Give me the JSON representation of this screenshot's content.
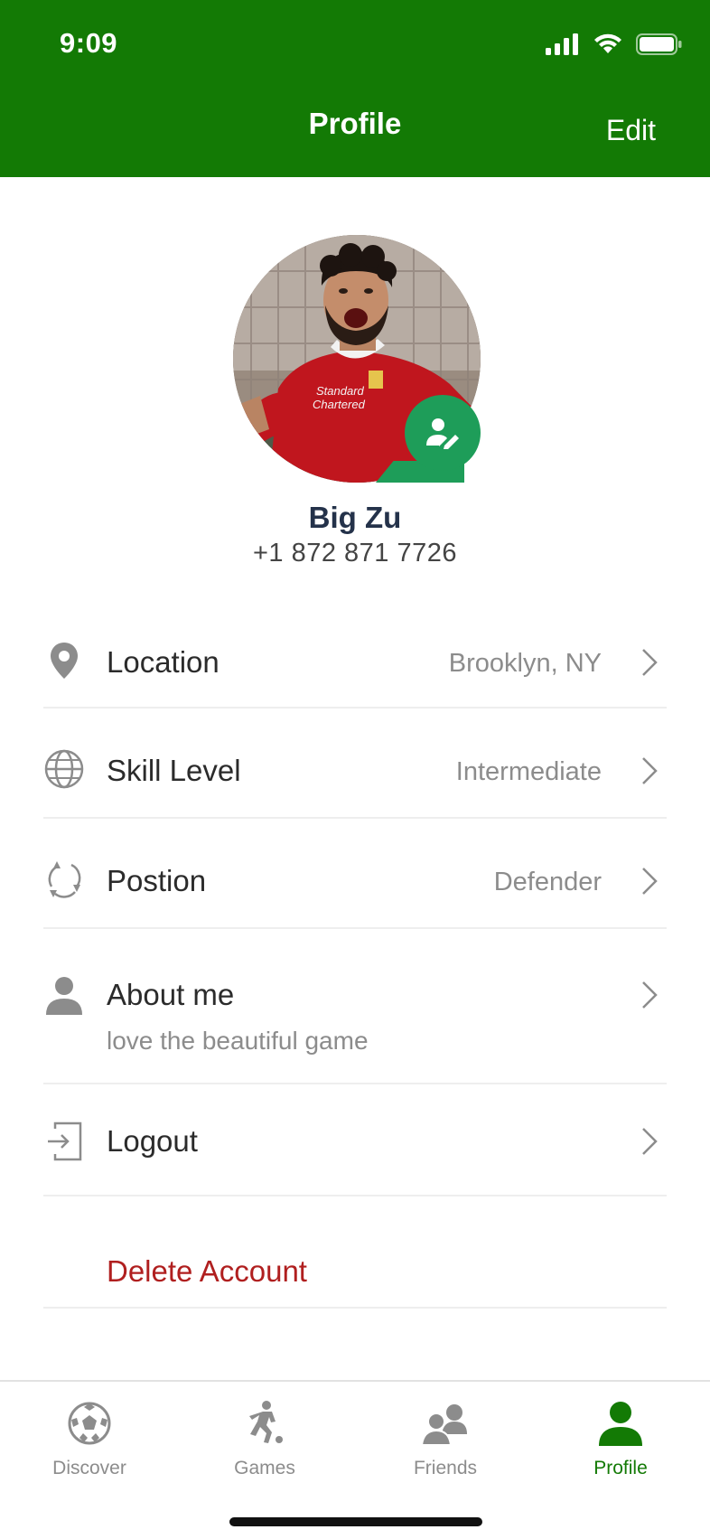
{
  "status_bar": {
    "time": "9:09"
  },
  "header": {
    "title": "Profile",
    "edit_label": "Edit"
  },
  "profile": {
    "name": "Big Zu",
    "phone": "+1 872 871 7726",
    "avatar_shirt_text_1": "Standard",
    "avatar_shirt_text_2": "Chartered"
  },
  "rows": [
    {
      "icon": "location-pin-icon",
      "label": "Location",
      "value": "Brooklyn, NY"
    },
    {
      "icon": "globe-icon",
      "label": "Skill Level",
      "value": "Intermediate"
    },
    {
      "icon": "rotate-icon",
      "label": "Postion",
      "value": "Defender"
    },
    {
      "icon": "person-icon",
      "label": "About me",
      "subtitle": "love the beautiful game"
    },
    {
      "icon": "logout-icon",
      "label": "Logout"
    }
  ],
  "delete_account": {
    "label": "Delete Account"
  },
  "tabs": [
    {
      "label": "Discover",
      "icon": "soccer-ball-icon",
      "active": false
    },
    {
      "label": "Games",
      "icon": "player-kick-icon",
      "active": false
    },
    {
      "label": "Friends",
      "icon": "friends-icon",
      "active": false
    },
    {
      "label": "Profile",
      "icon": "profile-person-icon",
      "active": true
    }
  ],
  "colors": {
    "brand_green": "#137A05",
    "badge_green": "#1E9D59",
    "danger_red": "#B01F1F",
    "name_navy": "#24324a"
  }
}
